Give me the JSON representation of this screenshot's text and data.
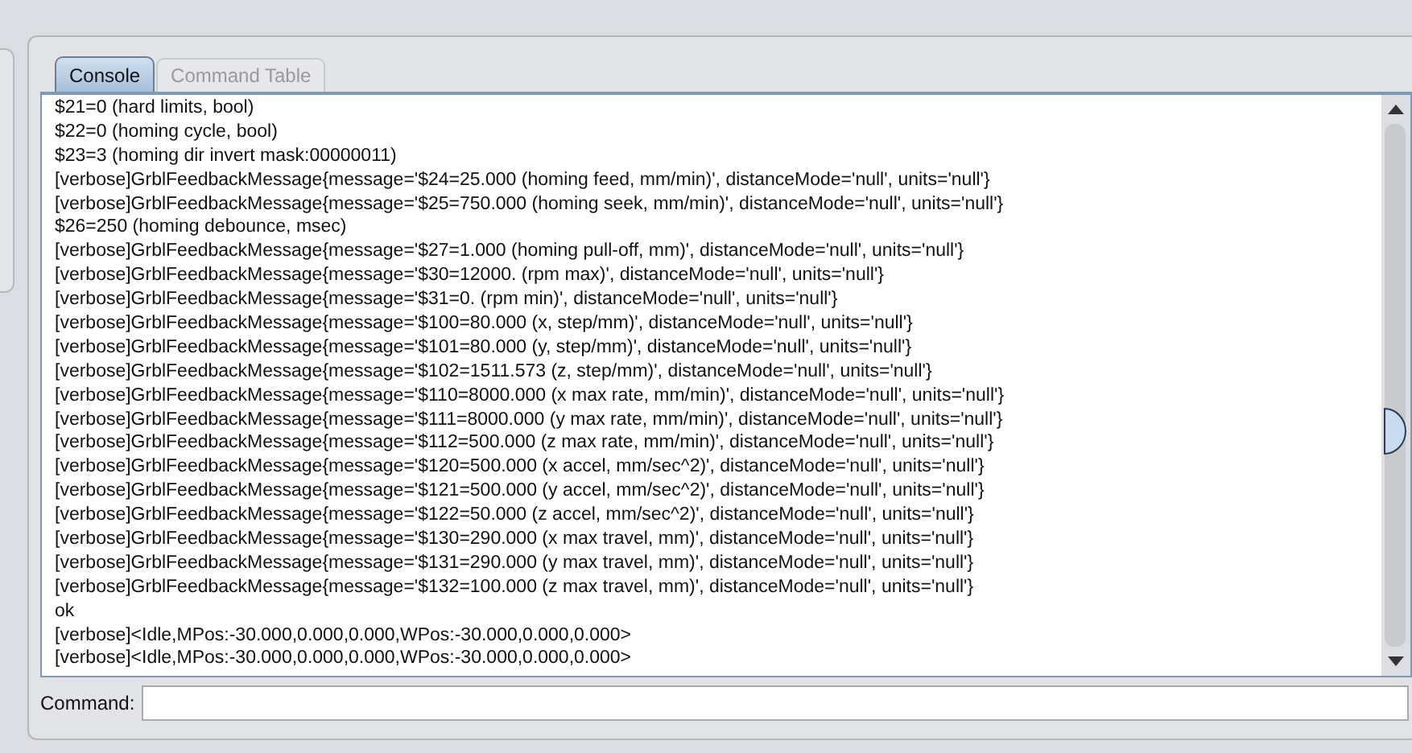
{
  "tabs": [
    {
      "label": "Console",
      "selected": true
    },
    {
      "label": "Command Table",
      "selected": false
    }
  ],
  "console_lines": [
    "$21=0 (hard limits, bool)",
    "$22=0 (homing cycle, bool)",
    "$23=3 (homing dir invert mask:00000011)",
    "[verbose]GrblFeedbackMessage{message='$24=25.000 (homing feed, mm/min)', distanceMode='null', units='null'}",
    "[verbose]GrblFeedbackMessage{message='$25=750.000 (homing seek, mm/min)', distanceMode='null', units='null'}",
    "$26=250 (homing debounce, msec)",
    "[verbose]GrblFeedbackMessage{message='$27=1.000 (homing pull-off, mm)', distanceMode='null', units='null'}",
    "[verbose]GrblFeedbackMessage{message='$30=12000. (rpm max)', distanceMode='null', units='null'}",
    "[verbose]GrblFeedbackMessage{message='$31=0. (rpm min)', distanceMode='null', units='null'}",
    "[verbose]GrblFeedbackMessage{message='$100=80.000 (x, step/mm)', distanceMode='null', units='null'}",
    "[verbose]GrblFeedbackMessage{message='$101=80.000 (y, step/mm)', distanceMode='null', units='null'}",
    "[verbose]GrblFeedbackMessage{message='$102=1511.573 (z, step/mm)', distanceMode='null', units='null'}",
    "[verbose]GrblFeedbackMessage{message='$110=8000.000 (x max rate, mm/min)', distanceMode='null', units='null'}",
    "[verbose]GrblFeedbackMessage{message='$111=8000.000 (y max rate, mm/min)', distanceMode='null', units='null'}",
    "[verbose]GrblFeedbackMessage{message='$112=500.000 (z max rate, mm/min)', distanceMode='null', units='null'}",
    "[verbose]GrblFeedbackMessage{message='$120=500.000 (x accel, mm/sec^2)', distanceMode='null', units='null'}",
    "[verbose]GrblFeedbackMessage{message='$121=500.000 (y accel, mm/sec^2)', distanceMode='null', units='null'}",
    "[verbose]GrblFeedbackMessage{message='$122=50.000 (z accel, mm/sec^2)', distanceMode='null', units='null'}",
    "[verbose]GrblFeedbackMessage{message='$130=290.000 (x max travel, mm)', distanceMode='null', units='null'}",
    "[verbose]GrblFeedbackMessage{message='$131=290.000 (y max travel, mm)', distanceMode='null', units='null'}",
    "[verbose]GrblFeedbackMessage{message='$132=100.000 (z max travel, mm)', distanceMode='null', units='null'}",
    "ok",
    "[verbose]<Idle,MPos:-30.000,0.000,0.000,WPos:-30.000,0.000,0.000>",
    "[verbose]<Idle,MPos:-30.000,0.000,0.000,WPos:-30.000,0.000,0.000>"
  ],
  "command": {
    "label": "Command:"
  }
}
